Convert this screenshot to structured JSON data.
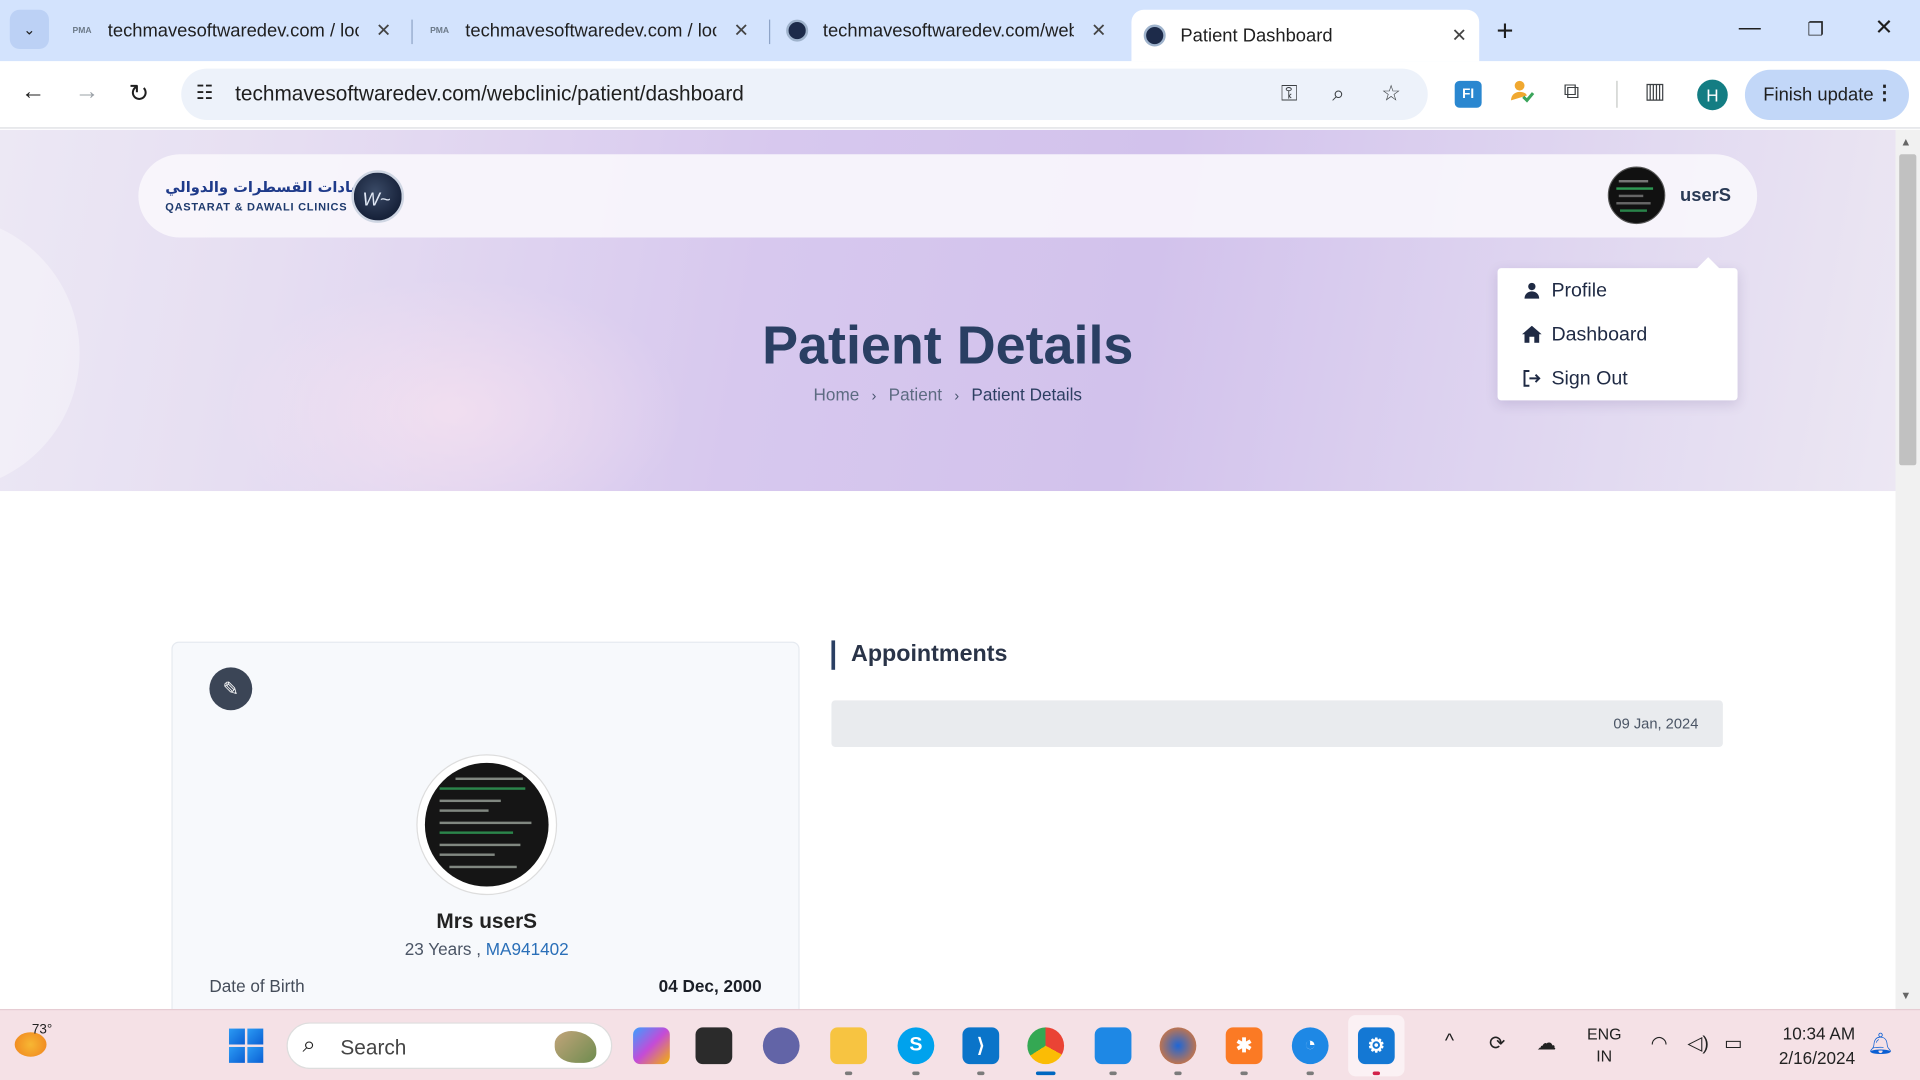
{
  "browser": {
    "tabs": [
      {
        "title": "techmavesoftwaredev.com / loc",
        "favicon": "phpmyadmin-icon"
      },
      {
        "title": "techmavesoftwaredev.com / loc",
        "favicon": "phpmyadmin-icon"
      },
      {
        "title": "techmavesoftwaredev.com/web",
        "favicon": "clinic-logo-icon"
      },
      {
        "title": "Patient Dashboard",
        "favicon": "clinic-logo-icon",
        "active": true
      }
    ],
    "url": "techmavesoftwaredev.com/webclinic/patient/dashboard",
    "profile_initial": "H",
    "update_button": "Finish update"
  },
  "site": {
    "logo_arabic": "عيادات القسطرات والدوالي",
    "logo_english": "QASTARAT & DAWALI CLINICS",
    "username": "userS",
    "user_menu": [
      "Profile",
      "Dashboard",
      "Sign Out"
    ],
    "page_title": "Patient Details",
    "breadcrumb": [
      "Home",
      "Patient",
      "Patient Details"
    ]
  },
  "patient": {
    "name": "Mrs userS",
    "age": "23 Years",
    "separator": " , ",
    "code": "MA941402",
    "dob_label": "Date of Birth",
    "dob_value": "04 Dec, 2000"
  },
  "appointments": {
    "title": "Appointments",
    "items": [
      {
        "date": "09 Jan, 2024"
      }
    ]
  },
  "taskbar": {
    "weather_temp": "73°",
    "search_placeholder": "Search",
    "language": "ENG",
    "region": "IN",
    "time": "10:34 AM",
    "date": "2/16/2024"
  },
  "colors": {
    "brand_navy": "#2a3f63",
    "tabstrip": "#d3e3fd",
    "hero_purple": "#d2c2ec",
    "link_blue": "#2a6fb8"
  }
}
